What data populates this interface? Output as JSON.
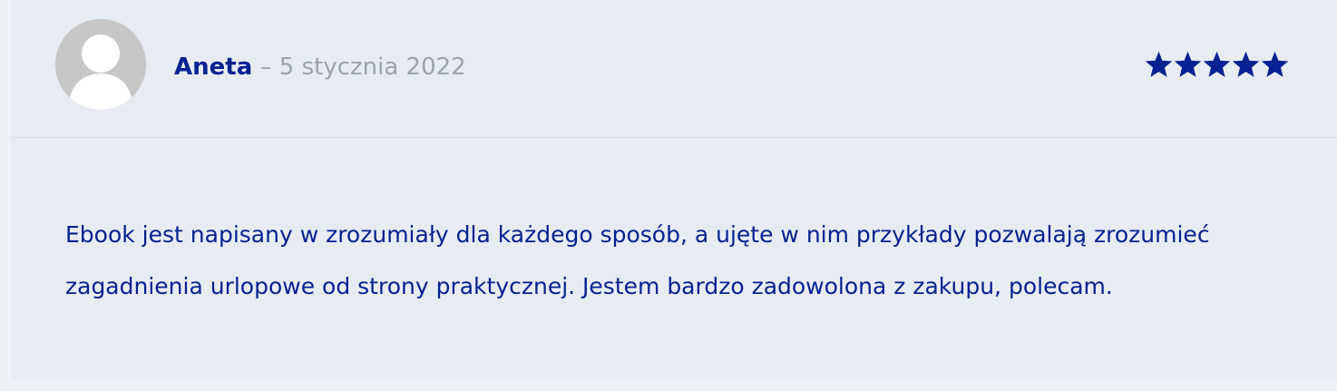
{
  "review": {
    "author": "Aneta",
    "separator": " – ",
    "date": "5 stycznia 2022",
    "rating": {
      "value": 5,
      "max": 5,
      "icon": "star-icon",
      "color": "#062191"
    },
    "text": "Ebook jest napisany w zrozumiały dla każdego sposób, a ujęte w nim przykłady pozwalają zrozumieć zagadnienia urlopowe od strony praktycznej. Jestem bardzo zadowolona z zakupu, polecam.",
    "avatar": {
      "icon": "user-avatar-icon",
      "color": "#c7c7c7"
    }
  },
  "colors": {
    "card_background": "#e7ecf2",
    "page_background": "#edf1f5",
    "divider": "#d7dde5",
    "text_primary": "#062191",
    "text_muted": "#9ca3aa"
  }
}
